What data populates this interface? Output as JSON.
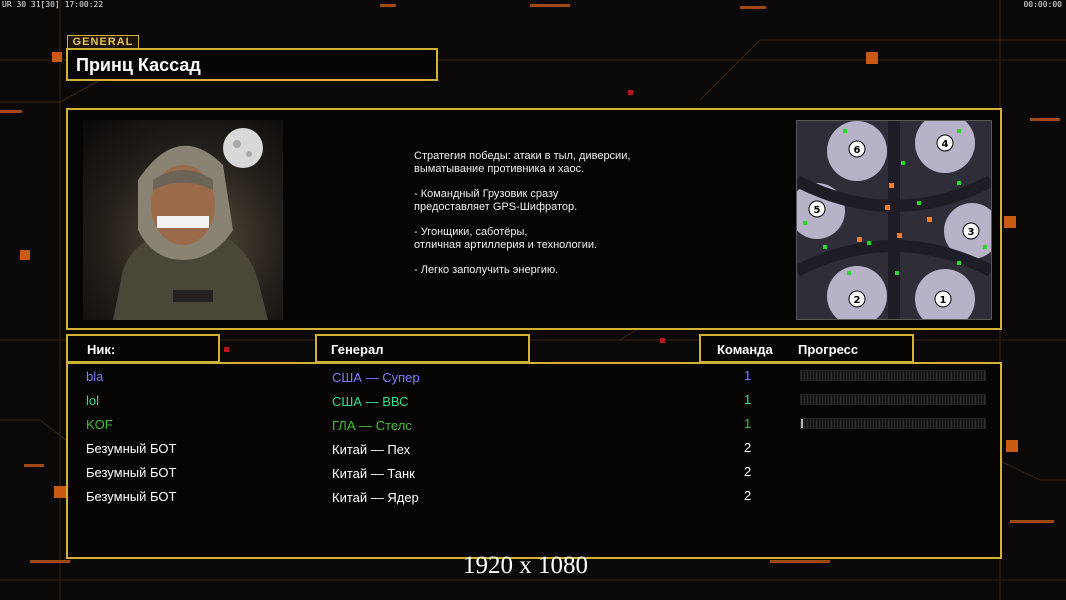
{
  "hud": {
    "left": "UR 30 31[30] 17:00:22",
    "right": "00:00:00"
  },
  "general_tag": "GENERAL",
  "general_name": "Принц Кассад",
  "description": [
    "Стратегия победы: атаки в тыл, диверсии,\n выматывание противника и хаос.",
    "- Командный Грузовик сразу\nпредоставляет GPS-Шифратор.",
    "- Угонщики, саботёры,\nотличная артиллерия и технологии.",
    "- Легко заполучить энергию."
  ],
  "minimap": {
    "start_labels": [
      "6",
      "4",
      "5",
      "3",
      "2",
      "1"
    ]
  },
  "headers": {
    "nick": "Ник:",
    "general": "Генерал",
    "team": "Команда",
    "progress": "Прогресс"
  },
  "players": [
    {
      "nick": "bla",
      "general": "США — Супер",
      "team": "1",
      "color": "#7f7cff",
      "progress": 0
    },
    {
      "nick": "lol",
      "general": "США — ВВС",
      "team": "1",
      "color": "#2ee08a",
      "progress": 0
    },
    {
      "nick": "KOF",
      "general": "ГЛА — Стелс",
      "team": "1",
      "color": "#3fbf2c",
      "progress": 0.01
    },
    {
      "nick": "Безумный БОТ",
      "general": "Китай — Пех",
      "team": "2",
      "color": "#ffffff",
      "progress": null
    },
    {
      "nick": "Безумный БОТ",
      "general": "Китай — Танк",
      "team": "2",
      "color": "#ffffff",
      "progress": null
    },
    {
      "nick": "Безумный БОТ",
      "general": "Китай — Ядер",
      "team": "2",
      "color": "#ffffff",
      "progress": null
    }
  ],
  "resolution_text": "1920 x 1080"
}
